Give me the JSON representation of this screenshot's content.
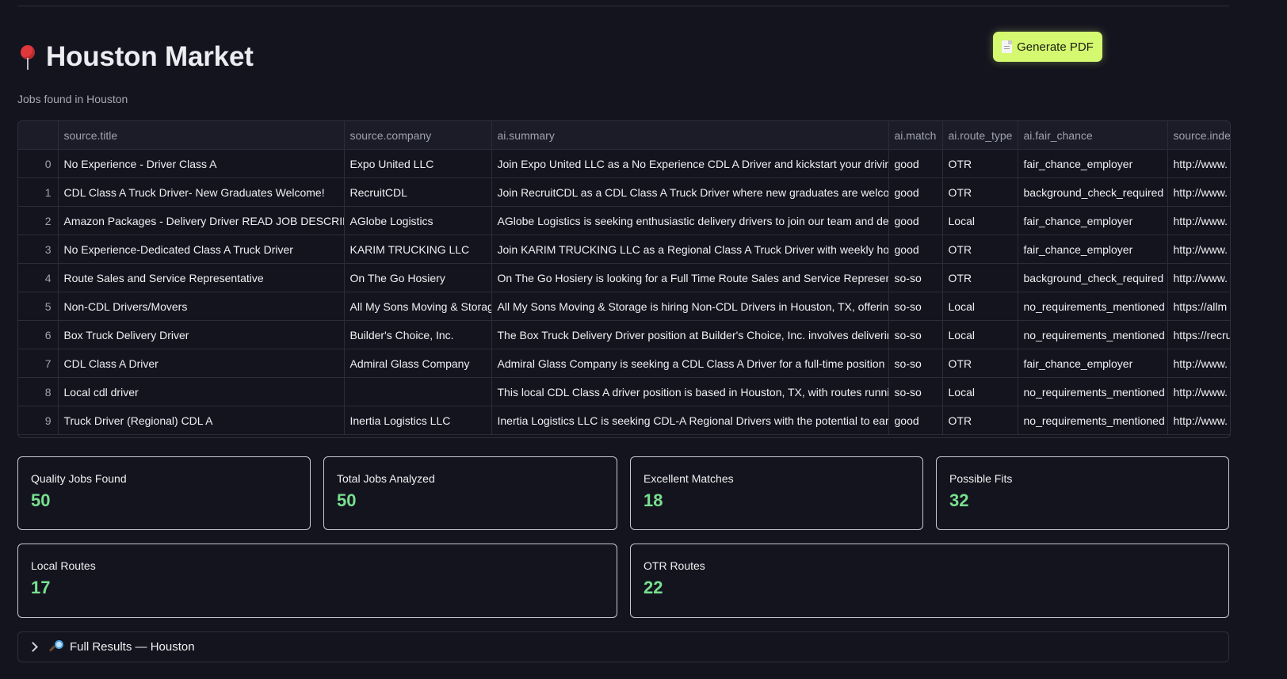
{
  "header": {
    "title": "Houston Market",
    "subtitle": "Jobs found in Houston",
    "pdf_button": "Generate PDF"
  },
  "table": {
    "columns": [
      "source.title",
      "source.company",
      "ai.summary",
      "ai.match",
      "ai.route_type",
      "ai.fair_chance",
      "source.inde"
    ],
    "rows": [
      {
        "idx": "0",
        "title": "No Experience - Driver Class A",
        "company": "Expo United LLC",
        "summary": "Join Expo United LLC as a No Experience CDL A Driver and kickstart your driving care",
        "match": "good",
        "route": "OTR",
        "fair": "fair_chance_employer",
        "url": "http://www."
      },
      {
        "idx": "1",
        "title": "CDL Class A Truck Driver- New Graduates Welcome!",
        "company": "RecruitCDL",
        "summary": "Join RecruitCDL as a CDL Class A Truck Driver where new graduates are welcome! Enj",
        "match": "good",
        "route": "OTR",
        "fair": "background_check_required",
        "url": "http://www."
      },
      {
        "idx": "2",
        "title": "Amazon Packages - Delivery Driver READ JOB DESCRIPTION",
        "company": "AGlobe Logistics",
        "summary": "AGlobe Logistics is seeking enthusiastic delivery drivers to join our team and deliver A",
        "match": "good",
        "route": "Local",
        "fair": "fair_chance_employer",
        "url": "http://www."
      },
      {
        "idx": "3",
        "title": "No Experience-Dedicated Class A Truck Driver",
        "company": "KARIM TRUCKING LLC",
        "summary": "Join KARIM TRUCKING LLC as a Regional Class A Truck Driver with weekly hometime!",
        "match": "good",
        "route": "OTR",
        "fair": "fair_chance_employer",
        "url": "http://www."
      },
      {
        "idx": "4",
        "title": "Route Sales and Service Representative",
        "company": "On The Go Hosiery",
        "summary": "On The Go Hosiery is looking for a Full Time Route Sales and Service Representative t",
        "match": "so-so",
        "route": "OTR",
        "fair": "background_check_required",
        "url": "http://www."
      },
      {
        "idx": "5",
        "title": "Non-CDL Drivers/Movers",
        "company": "All My Sons Moving & Storage",
        "summary": "All My Sons Moving & Storage is hiring Non-CDL Drivers in Houston, TX, offering pay b",
        "match": "so-so",
        "route": "Local",
        "fair": "no_requirements_mentioned",
        "url": "https://allm"
      },
      {
        "idx": "6",
        "title": "Box Truck Delivery Driver",
        "company": "Builder's Choice, Inc.",
        "summary": "The Box Truck Delivery Driver position at Builder's Choice, Inc. involves delivering cab",
        "match": "so-so",
        "route": "Local",
        "fair": "no_requirements_mentioned",
        "url": "https://recru"
      },
      {
        "idx": "7",
        "title": "CDL Class A Driver",
        "company": "Admiral Glass Company",
        "summary": "Admiral Glass Company is seeking a CDL Class A Driver for a full-time position in Hous",
        "match": "so-so",
        "route": "OTR",
        "fair": "fair_chance_employer",
        "url": "http://www."
      },
      {
        "idx": "8",
        "title": "Local cdl driver",
        "company": "",
        "summary": "This local CDL Class A driver position is based in Houston, TX, with routes running fro",
        "match": "so-so",
        "route": "Local",
        "fair": "no_requirements_mentioned",
        "url": "http://www."
      },
      {
        "idx": "9",
        "title": "Truck Driver (Regional) CDL A",
        "company": "Inertia Logistics LLC",
        "summary": "Inertia Logistics LLC is seeking CDL-A Regional Drivers with the potential to earn up to",
        "match": "good",
        "route": "OTR",
        "fair": "no_requirements_mentioned",
        "url": "http://www."
      }
    ]
  },
  "metrics": [
    {
      "label": "Quality Jobs Found",
      "value": "50"
    },
    {
      "label": "Total Jobs Analyzed",
      "value": "50"
    },
    {
      "label": "Excellent Matches",
      "value": "18"
    },
    {
      "label": "Possible Fits",
      "value": "32"
    },
    {
      "label": "Local Routes",
      "value": "17"
    },
    {
      "label": "OTR Routes",
      "value": "22"
    }
  ],
  "expander": {
    "label": "Full Results — Houston"
  },
  "colors": {
    "background": "#14141f",
    "accent": "#d4f870",
    "metric_value": "#78e08f"
  }
}
